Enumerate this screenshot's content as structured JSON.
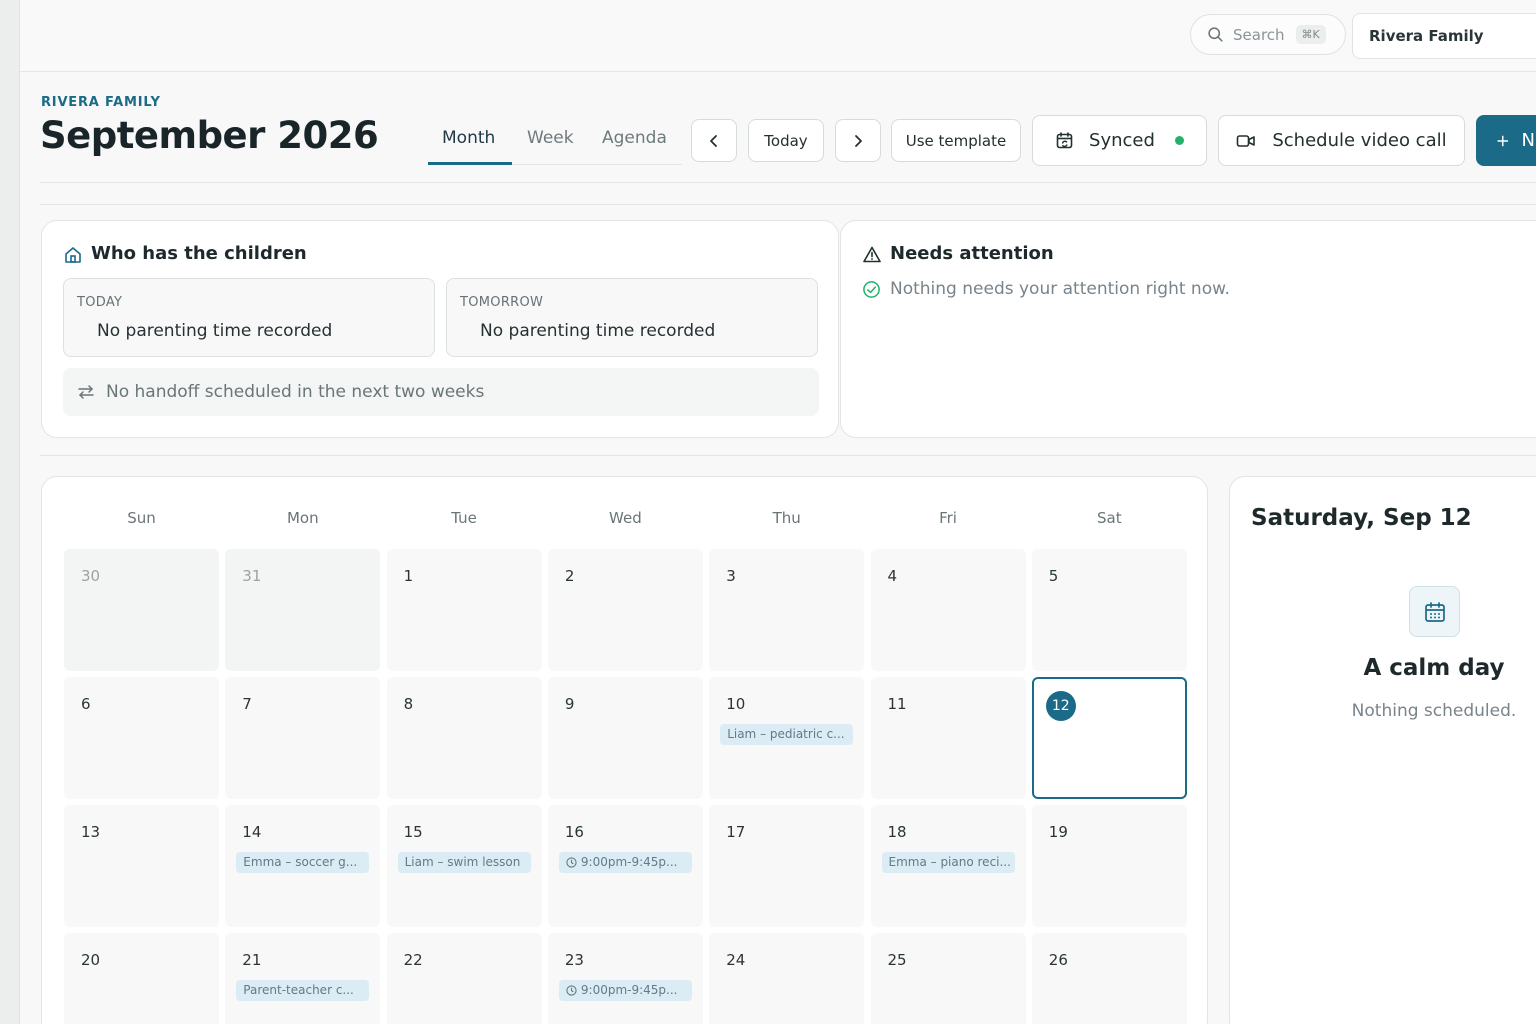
{
  "topbar": {
    "search_placeholder": "Search",
    "search_shortcut": "⌘K",
    "family_selector": "Rivera Family"
  },
  "header": {
    "eyebrow": "RIVERA FAMILY",
    "title": "September 2026",
    "view_tabs": [
      {
        "label": "Month",
        "active": true
      },
      {
        "label": "Week",
        "active": false
      },
      {
        "label": "Agenda",
        "active": false
      }
    ],
    "today_label": "Today",
    "use_template_label": "Use template",
    "synced_label": "Synced",
    "schedule_video_label": "Schedule video call",
    "new_label": "N"
  },
  "custody_card": {
    "title": "Who has the children",
    "today_label": "TODAY",
    "today_value": "No parenting time recorded",
    "tomorrow_label": "TOMORROW",
    "tomorrow_value": "No parenting time recorded",
    "handoff_text": "No handoff scheduled in the next two weeks"
  },
  "attention_card": {
    "title": "Needs attention",
    "message": "Nothing needs your attention right now."
  },
  "calendar": {
    "weekdays": [
      "Sun",
      "Mon",
      "Tue",
      "Wed",
      "Thu",
      "Fri",
      "Sat"
    ],
    "weeks": [
      [
        {
          "day": "30",
          "out": true
        },
        {
          "day": "31",
          "out": true
        },
        {
          "day": "1"
        },
        {
          "day": "2"
        },
        {
          "day": "3"
        },
        {
          "day": "4"
        },
        {
          "day": "5"
        }
      ],
      [
        {
          "day": "6"
        },
        {
          "day": "7"
        },
        {
          "day": "8"
        },
        {
          "day": "9"
        },
        {
          "day": "10",
          "event": "Liam – pediatric c..."
        },
        {
          "day": "11"
        },
        {
          "day": "12",
          "selected": true
        }
      ],
      [
        {
          "day": "13"
        },
        {
          "day": "14",
          "event": "Emma – soccer g..."
        },
        {
          "day": "15",
          "event": "Liam – swim lesson"
        },
        {
          "day": "16",
          "event": "9:00pm-9:45p...",
          "timed": true
        },
        {
          "day": "17"
        },
        {
          "day": "18",
          "event": "Emma – piano reci..."
        },
        {
          "day": "19"
        }
      ],
      [
        {
          "day": "20"
        },
        {
          "day": "21",
          "event": "Parent-teacher c..."
        },
        {
          "day": "22"
        },
        {
          "day": "23",
          "event": "9:00pm-9:45p...",
          "timed": true
        },
        {
          "day": "24"
        },
        {
          "day": "25"
        },
        {
          "day": "26"
        }
      ]
    ]
  },
  "day_panel": {
    "title": "Saturday, Sep 12",
    "empty_title": "A calm day",
    "empty_subtitle": "Nothing scheduled."
  },
  "colors": {
    "accent": "#1b6b88",
    "synced_dot": "#23b26a",
    "event_bg": "#dcecf5"
  }
}
